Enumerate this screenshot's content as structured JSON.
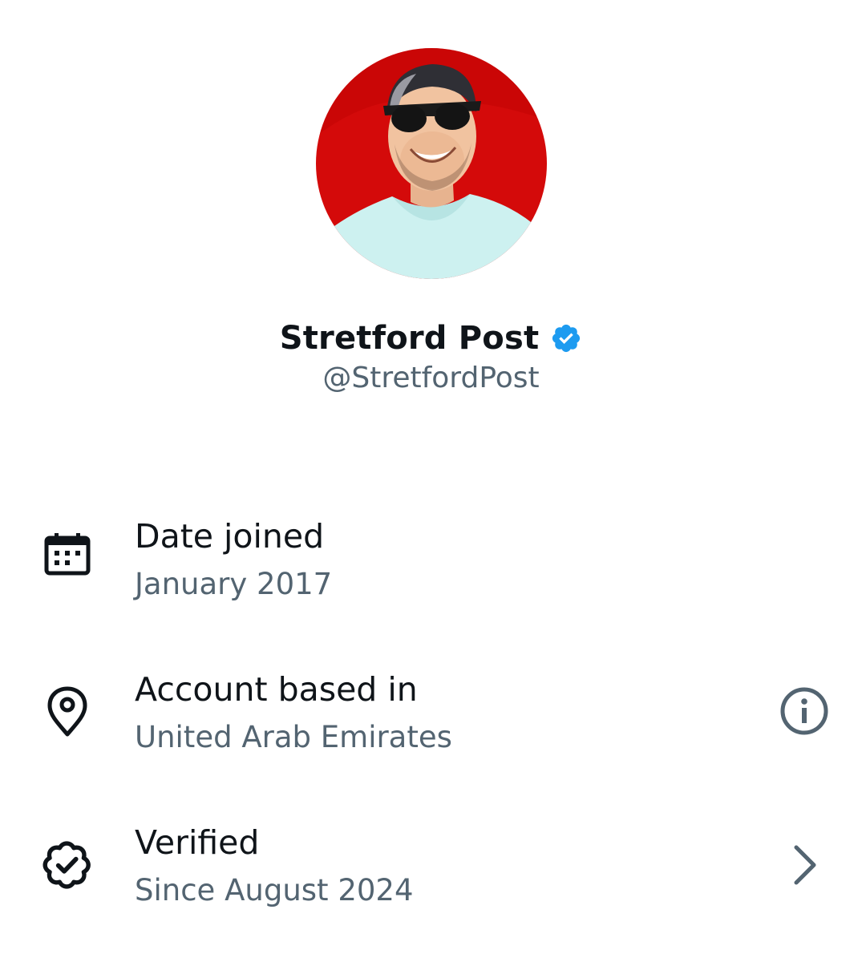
{
  "profile": {
    "display_name": "Stretford Post",
    "handle": "@StretfordPost",
    "verified": true,
    "badge_color": "#1d9bf0",
    "avatar_background": "#d40a0a"
  },
  "about": [
    {
      "icon": "calendar-icon",
      "title": "Date joined",
      "value": "January 2017",
      "action_icon": ""
    },
    {
      "icon": "location-pin-icon",
      "title": "Account based in",
      "value": "United Arab Emirates",
      "action_icon": "info-icon"
    },
    {
      "icon": "verified-badge-outline-icon",
      "title": "Verified",
      "value": "Since August 2024",
      "action_icon": "chevron-right-icon"
    }
  ],
  "colors": {
    "primary_text": "#0f1419",
    "secondary_text": "#536471",
    "accent": "#1d9bf0"
  }
}
